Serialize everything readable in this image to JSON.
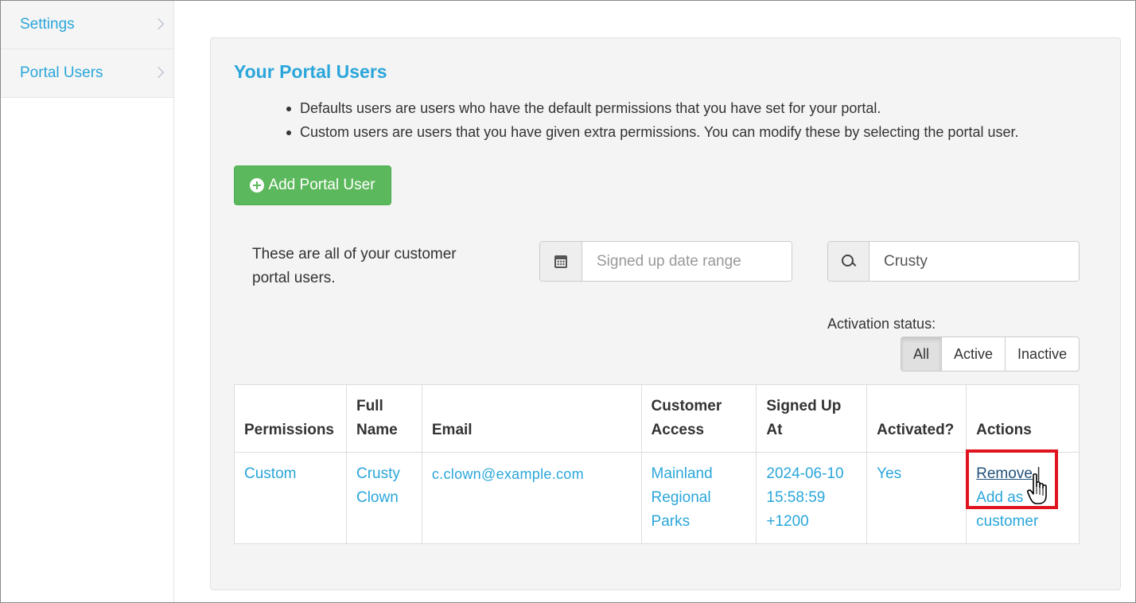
{
  "sidebar": {
    "items": [
      {
        "label": "Settings"
      },
      {
        "label": "Portal Users"
      }
    ]
  },
  "main": {
    "title": "Your Portal Users",
    "bullets": [
      "Defaults users are users who have the default permissions that you have set for your portal.",
      "Custom users are users that you have given extra permissions. You can modify these by selecting the portal user."
    ],
    "add_button_label": "Add Portal User",
    "description": "These are all of your customer portal users.",
    "date_filter": {
      "placeholder": "Signed up date range",
      "icon": "calendar-icon"
    },
    "search": {
      "value": "Crusty",
      "icon": "search-icon"
    },
    "activation_status": {
      "label": "Activation status:",
      "options": [
        "All",
        "Active",
        "Inactive"
      ],
      "selected": "All"
    }
  },
  "table": {
    "headers": [
      "Permissions",
      "Full Name",
      "Email",
      "Customer Access",
      "Signed Up At",
      "Activated?",
      "Actions"
    ],
    "rows": [
      {
        "permissions": "Custom",
        "full_name": "Crusty Clown",
        "email": "c.clown@example.com",
        "customer_access": "Mainland Regional Parks",
        "signed_up_at": "2024-06-10 15:58:59 +1200",
        "activated": "Yes",
        "action_remove": "Remove",
        "action_separator": "|",
        "action_add": "Add as customer"
      }
    ]
  },
  "colors": {
    "accent": "#2aa6da",
    "success": "#5cb85c",
    "highlight": "#e0141e"
  }
}
